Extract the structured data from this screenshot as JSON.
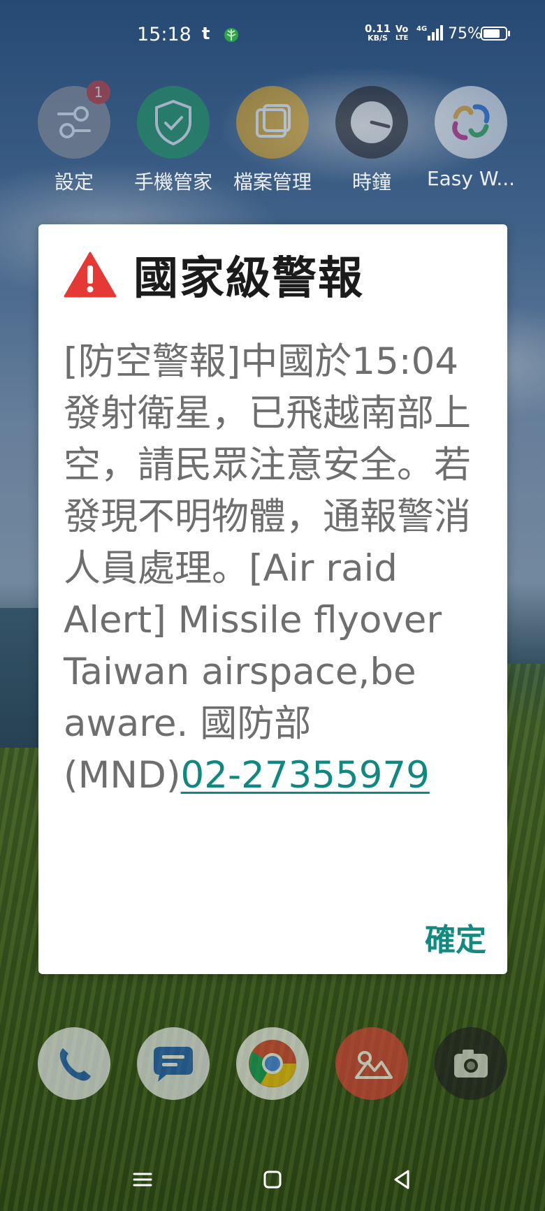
{
  "status_bar": {
    "time": "15:18",
    "notification_letter": "t",
    "net_speed_value": "0.11",
    "net_speed_unit": "KB/S",
    "volte_line1": "Vo",
    "volte_line2": "LTE",
    "network": "4G",
    "battery": "75%",
    "battery_level": 0.75
  },
  "home_apps": [
    {
      "label": "設定",
      "icon": "settings-icon",
      "badge": "1",
      "color": "#8e8e93"
    },
    {
      "label": "手機管家",
      "icon": "shield-check-icon",
      "color": "#1f9a5b"
    },
    {
      "label": "檔案管理",
      "icon": "folder-icon",
      "color": "#e3a51c"
    },
    {
      "label": "時鐘",
      "icon": "clock-icon",
      "color": "#1a1a1f"
    },
    {
      "label": "Easy W...",
      "icon": "easy-wallet-icon",
      "color": "#f2f2f2"
    }
  ],
  "dock": [
    {
      "icon": "phone-icon",
      "color": "#e8eaf0"
    },
    {
      "icon": "messages-icon",
      "color": "#e8eaf0"
    },
    {
      "icon": "chrome-icon",
      "color": "#f1f1f1"
    },
    {
      "icon": "gallery-icon",
      "color": "#d8403a"
    },
    {
      "icon": "camera-icon",
      "color": "#1d1d22"
    }
  ],
  "alert": {
    "title": "國家級警報",
    "message": "[防空警報]中國於15:04發射衛星，已飛越南部上空，請民眾注意安全。若發現不明物體，通報警消人員處理。[Air raid Alert] Missile flyover Taiwan airspace,be aware. 國防部(MND)",
    "phone_link": "02-27355979",
    "confirm_label": "確定",
    "accent_color": "#138a80",
    "warning_color": "#e53935"
  }
}
